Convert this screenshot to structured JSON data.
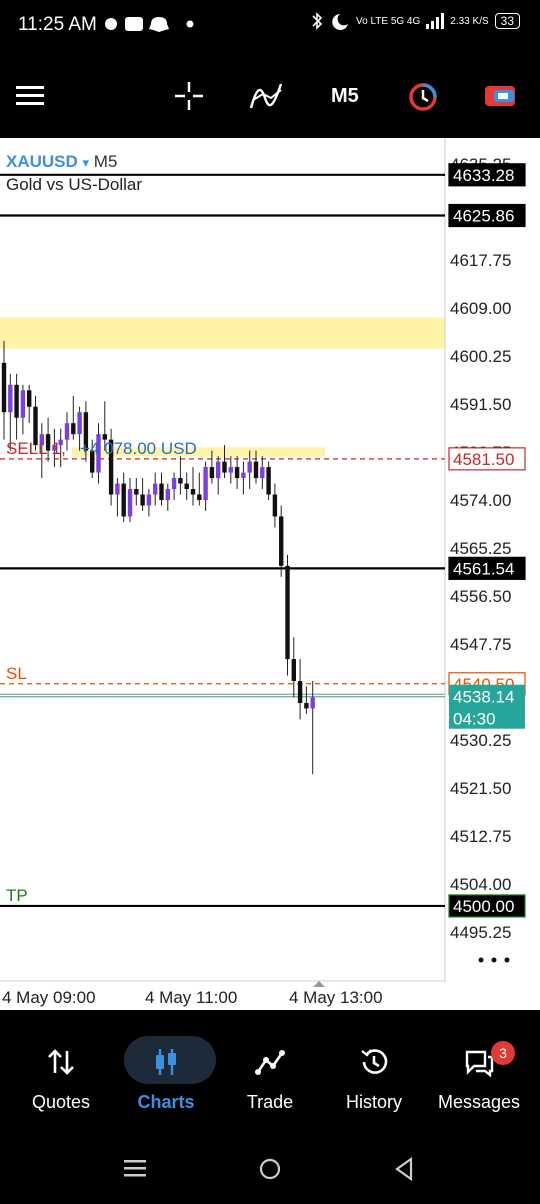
{
  "status_bar": {
    "time": "11:25 AM",
    "left_icons": [
      "dot-icon",
      "temu-icon",
      "snapchat-icon",
      "dot-icon"
    ],
    "network": "Vo LTE 5G 4G",
    "speed": "2.33 K/S",
    "battery": "33"
  },
  "toolbar": {
    "timeframe": "M5"
  },
  "chart": {
    "symbol": "XAUUSD",
    "symbol_arrow": "▾",
    "timeframe": "M5",
    "description": "Gold vs US-Dollar",
    "price_ticks": [
      "4635.25",
      "4626.50",
      "4617.75",
      "4609.00",
      "4600.25",
      "4591.50",
      "4582.75",
      "4574.00",
      "4565.25",
      "4556.50",
      "4547.75",
      "4539.00",
      "4530.25",
      "4521.50",
      "4512.75",
      "4504.00",
      "4495.25"
    ],
    "price_labels": {
      "line_top": "4633.28",
      "line_2": "4625.86",
      "sell": "4581.50",
      "line_mid": "4561.54",
      "sl": "4540.50",
      "current": "4538.14",
      "timer": "04:30",
      "tp": "4500.00"
    },
    "order_label": {
      "prefix": "SELL 1,",
      "profit": "+4 078.00 USD"
    },
    "sl_label": "SL",
    "tp_label": "TP",
    "time_labels": [
      "4 May 09:00",
      "4 May 11:00",
      "4 May 13:00"
    ],
    "more_icon": "more-horizontal-icon",
    "colors": {
      "sell": "#c62828",
      "sl": "#e65100",
      "tp": "#1b7f1b",
      "current_bg": "#26a69a",
      "candle_bull": "#7b3fe4",
      "candle_bear": "#111111",
      "zone": "#fff3a8"
    }
  },
  "chart_data": {
    "type": "candlestick",
    "symbol": "XAUUSD",
    "timeframe": "M5",
    "x_labels": [
      "4 May 09:00",
      "4 May 11:00",
      "4 May 13:00"
    ],
    "ylim": [
      4492,
      4640
    ],
    "candles": [
      [
        4599,
        4603,
        4585,
        4590
      ],
      [
        4590,
        4597,
        4583,
        4595
      ],
      [
        4595,
        4597,
        4585,
        4589
      ],
      [
        4589,
        4595,
        4586,
        4594
      ],
      [
        4594,
        4595,
        4588,
        4591
      ],
      [
        4591,
        4593,
        4583,
        4584
      ],
      [
        4584,
        4588,
        4578,
        4586
      ],
      [
        4586,
        4589,
        4581,
        4583
      ],
      [
        4583,
        4587,
        4580,
        4584
      ],
      [
        4584,
        4587,
        4580,
        4585
      ],
      [
        4585,
        4590,
        4583,
        4588
      ],
      [
        4588,
        4593,
        4585,
        4586
      ],
      [
        4586,
        4591,
        4583,
        4590
      ],
      [
        4590,
        4592,
        4581,
        4583
      ],
      [
        4583,
        4585,
        4578,
        4579
      ],
      [
        4579,
        4588,
        4577,
        4586
      ],
      [
        4586,
        4592,
        4583,
        4585
      ],
      [
        4585,
        4587,
        4573,
        4575
      ],
      [
        4575,
        4578,
        4571,
        4577
      ],
      [
        4577,
        4579,
        4570,
        4571
      ],
      [
        4571,
        4578,
        4570,
        4576
      ],
      [
        4576,
        4578,
        4573,
        4575
      ],
      [
        4575,
        4578,
        4572,
        4573
      ],
      [
        4573,
        4576,
        4571,
        4575
      ],
      [
        4575,
        4579,
        4573,
        4577
      ],
      [
        4577,
        4579,
        4573,
        4574
      ],
      [
        4574,
        4577,
        4572,
        4576
      ],
      [
        4576,
        4579,
        4574,
        4578
      ],
      [
        4578,
        4582,
        4575,
        4577
      ],
      [
        4577,
        4579,
        4574,
        4576
      ],
      [
        4576,
        4580,
        4573,
        4575
      ],
      [
        4575,
        4579,
        4573,
        4574
      ],
      [
        4574,
        4581,
        4572,
        4580
      ],
      [
        4580,
        4583,
        4577,
        4578
      ],
      [
        4578,
        4582,
        4575,
        4581
      ],
      [
        4581,
        4584,
        4578,
        4579
      ],
      [
        4579,
        4582,
        4577,
        4580
      ],
      [
        4580,
        4582,
        4576,
        4578
      ],
      [
        4578,
        4581,
        4575,
        4579
      ],
      [
        4579,
        4583,
        4576,
        4581
      ],
      [
        4581,
        4583,
        4577,
        4578
      ],
      [
        4578,
        4582,
        4576,
        4580
      ],
      [
        4580,
        4581,
        4574,
        4575
      ],
      [
        4575,
        4577,
        4569,
        4571
      ],
      [
        4571,
        4573,
        4560,
        4562
      ],
      [
        4562,
        4564,
        4542,
        4545
      ],
      [
        4545,
        4549,
        4538,
        4541
      ],
      [
        4541,
        4545,
        4534,
        4537
      ],
      [
        4537,
        4540,
        4535,
        4536
      ],
      [
        4536,
        4541,
        4524,
        4538
      ]
    ]
  },
  "nav": {
    "items": [
      {
        "label": "Quotes",
        "icon": "quotes-icon"
      },
      {
        "label": "Charts",
        "icon": "charts-icon"
      },
      {
        "label": "Trade",
        "icon": "trade-icon"
      },
      {
        "label": "History",
        "icon": "history-icon"
      },
      {
        "label": "Messages",
        "icon": "messages-icon"
      }
    ],
    "active": "Charts",
    "messages_badge": "3",
    "active_color": "#3d8fe0"
  }
}
